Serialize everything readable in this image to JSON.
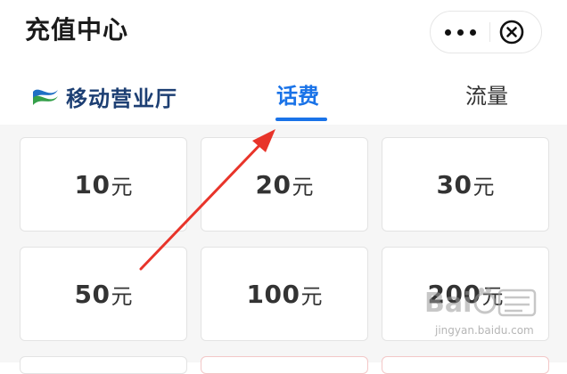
{
  "header": {
    "title": "充值中心",
    "more_icon": "more-dots-icon",
    "close_icon": "close-circle-icon"
  },
  "tabs": {
    "brand": "移动营业厅",
    "brand_icon": "china-mobile-logo-icon",
    "items": [
      {
        "label": "话费",
        "active": true
      },
      {
        "label": "流量",
        "active": false
      }
    ],
    "active_color": "#1a73e8"
  },
  "amounts": {
    "unit": "元",
    "items": [
      "10",
      "20",
      "30",
      "50",
      "100",
      "200"
    ]
  },
  "watermark": {
    "text": "jingyan.baidu.com"
  },
  "annotation": {
    "color": "#e8342a"
  }
}
